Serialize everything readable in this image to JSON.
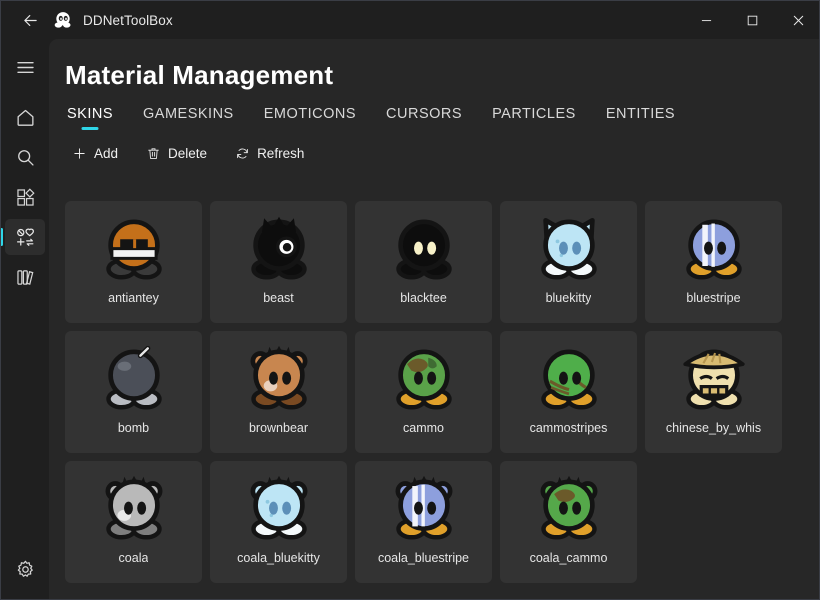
{
  "window": {
    "app_title": "DDNetToolBox",
    "back_icon": "back-arrow-icon",
    "app_logo_icon": "ddnet-tee-icon",
    "controls": {
      "minimize": "minimize-icon",
      "maximize": "maximize-icon",
      "close": "close-icon"
    }
  },
  "sidebar": {
    "items": [
      {
        "icon": "hamburger-menu-icon",
        "name": "menu-toggle",
        "selected": false
      },
      {
        "icon": "home-icon",
        "name": "home",
        "selected": false
      },
      {
        "icon": "search-icon",
        "name": "search",
        "selected": false
      },
      {
        "icon": "apps-grid-icon",
        "name": "tools",
        "selected": false
      },
      {
        "icon": "material-management-icon",
        "name": "material-management",
        "selected": true
      },
      {
        "icon": "library-books-icon",
        "name": "library",
        "selected": false
      }
    ],
    "bottom": {
      "icon": "settings-gear-icon",
      "name": "settings"
    }
  },
  "main": {
    "title": "Material Management",
    "tabs": [
      {
        "label": "SKINS",
        "active": true
      },
      {
        "label": "GAMESKINS",
        "active": false
      },
      {
        "label": "EMOTICONS",
        "active": false
      },
      {
        "label": "CURSORS",
        "active": false
      },
      {
        "label": "PARTICLES",
        "active": false
      },
      {
        "label": "ENTITIES",
        "active": false
      }
    ],
    "toolbar": [
      {
        "label": "Add",
        "icon": "plus-icon"
      },
      {
        "label": "Delete",
        "icon": "trash-icon"
      },
      {
        "label": "Refresh",
        "icon": "refresh-icon"
      }
    ],
    "items": [
      {
        "label": "antiantey",
        "art": "antiantey"
      },
      {
        "label": "beast",
        "art": "beast"
      },
      {
        "label": "blacktee",
        "art": "blacktee"
      },
      {
        "label": "bluekitty",
        "art": "bluekitty"
      },
      {
        "label": "bluestripe",
        "art": "bluestripe"
      },
      {
        "label": "bomb",
        "art": "bomb"
      },
      {
        "label": "brownbear",
        "art": "brownbear"
      },
      {
        "label": "cammo",
        "art": "cammo"
      },
      {
        "label": "cammostripes",
        "art": "cammostripes"
      },
      {
        "label": "chinese_by_whis",
        "art": "chinese"
      },
      {
        "label": "coala",
        "art": "coala"
      },
      {
        "label": "coala_bluekitty",
        "art": "coala_bluekitty"
      },
      {
        "label": "coala_bluestripe",
        "art": "coala_bluestripe"
      },
      {
        "label": "coala_cammo",
        "art": "coala_cammo"
      }
    ]
  },
  "colors": {
    "accent": "#2fd6e8",
    "window_bg": "#1f1f1f",
    "content_bg": "#272727",
    "card_bg": "#333333"
  }
}
